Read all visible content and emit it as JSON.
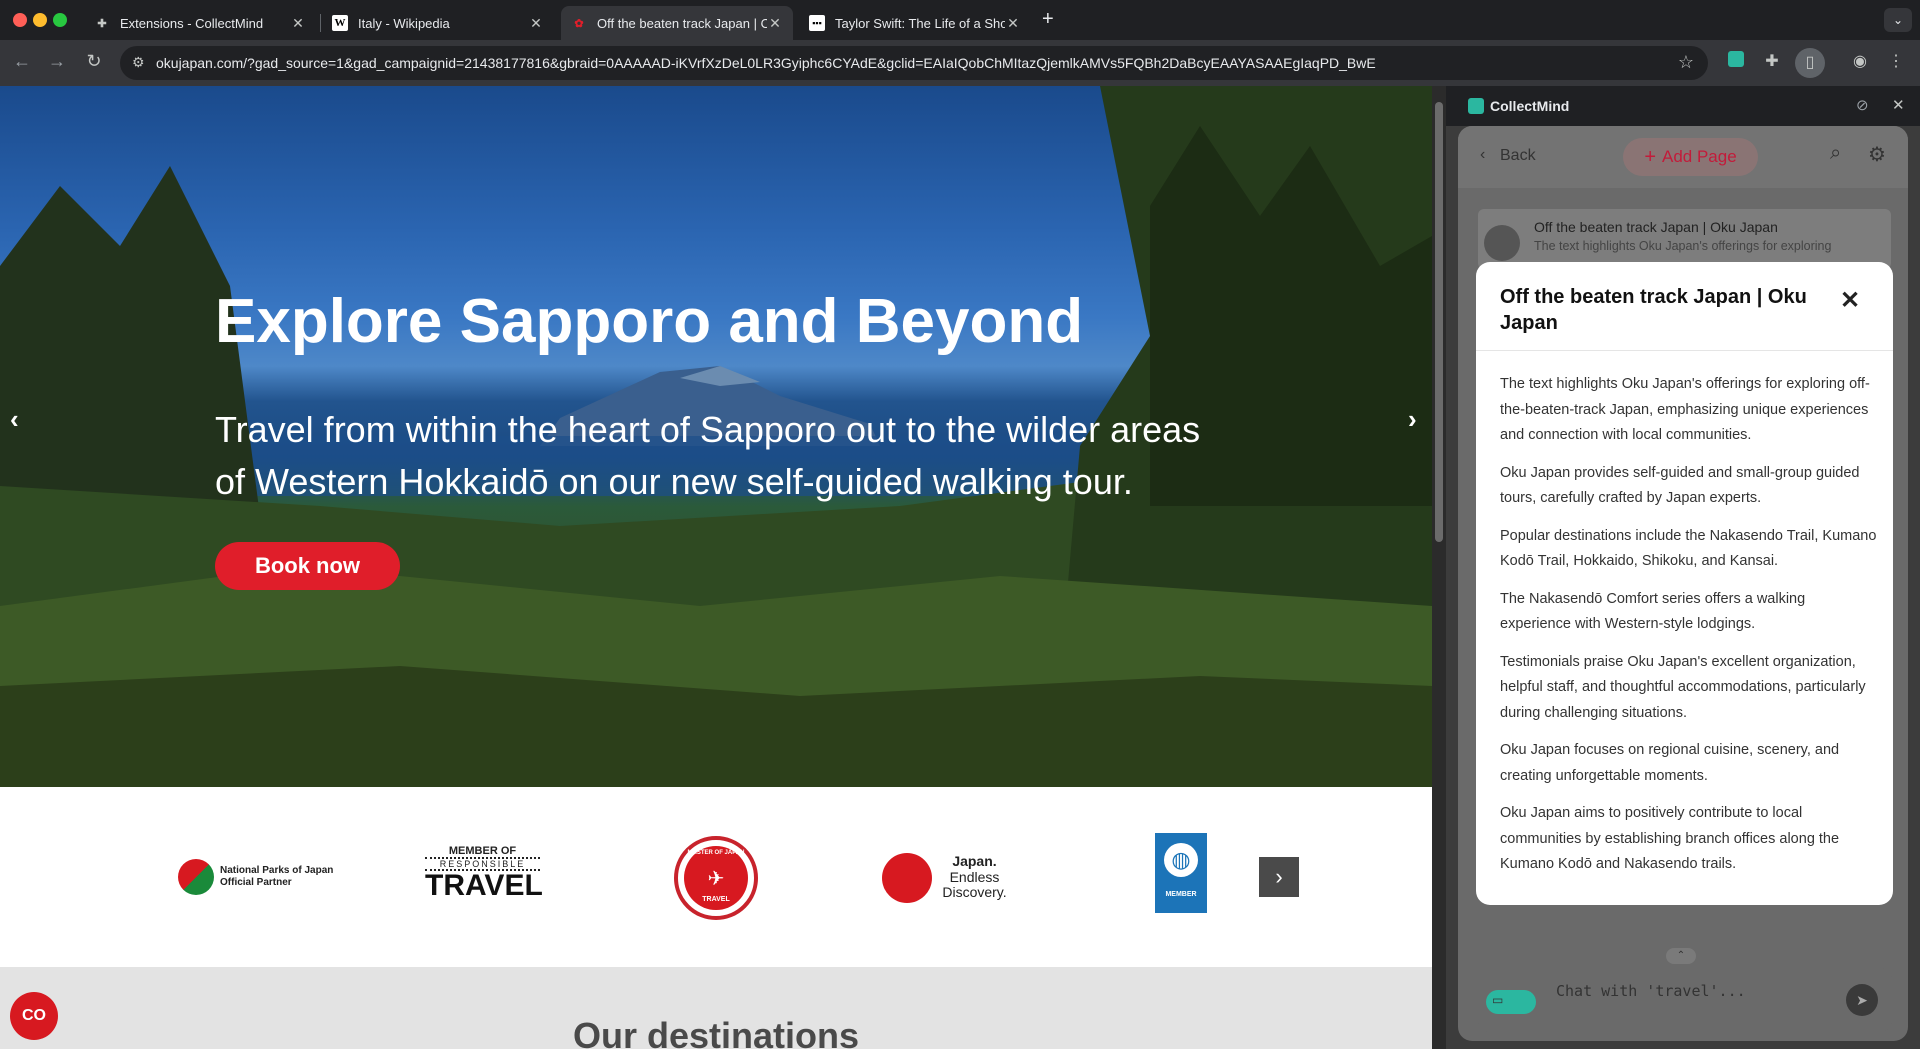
{
  "browser": {
    "tabs": [
      {
        "title": "Extensions - CollectMind",
        "icon": "puzzle-icon"
      },
      {
        "title": "Italy - Wikipedia",
        "icon": "wikipedia-icon"
      },
      {
        "title": "Off the beaten track Japan | O",
        "icon": "okujapan-favicon"
      },
      {
        "title": "Taylor Swift: The Life of a Sho",
        "icon": "site-favicon"
      }
    ],
    "new_tab": "+",
    "url": "okujapan.com/?gad_source=1&gad_campaignid=21438177816&gbraid=0AAAAAD-iKVrfXzDeL0LR3Gyiphc6CYAdE&gclid=EAIaIQobChMItazQjemlkAMVs5FQBh2DaBcyEAAYASAAEgIaqPD_BwE"
  },
  "hero": {
    "title": "Explore Sapporo and Beyond",
    "subtitle": "Travel from within the heart of Sapporo out to the wilder areas of Western Hokkaidō on our new self-guided walking tour.",
    "cta": "Book now"
  },
  "logos": [
    {
      "name": "National Parks of Japan Official Partner",
      "line1": "National Parks of Japan",
      "line2": "Official Partner"
    },
    {
      "name": "Member of Responsible Travel",
      "line1": "MEMBER OF",
      "line2": "RESPONSIBLE",
      "line3": "TRAVEL"
    },
    {
      "name": "Master of Japan Travel",
      "line1": "MASTER OF JAPAN",
      "line2": "TRAVEL"
    },
    {
      "name": "Japan. Endless Discovery.",
      "line1": "Japan.",
      "line2": "Endless",
      "line3": "Discovery."
    },
    {
      "name": "Member badge",
      "line1": "MEMBER"
    }
  ],
  "destinations": {
    "heading": "Our destinations"
  },
  "cc_button": "CO",
  "sidebar": {
    "title": "CollectMind",
    "back": "Back",
    "add_page": "Add Page",
    "card": {
      "title": "Off the beaten track Japan | Oku Japan",
      "snippet": "The text highlights Oku Japan's offerings for exploring"
    },
    "modal": {
      "title": "Off the beaten track Japan | Oku Japan",
      "points": [
        "The text highlights Oku Japan's offerings for exploring off-the-beaten-track Japan, emphasizing unique experiences and connection with local communities.",
        "Oku Japan provides self-guided and small-group guided tours, carefully crafted by Japan experts.",
        "Popular destinations include the Nakasendo Trail, Kumano Kodō Trail, Hokkaido, Shikoku, and Kansai.",
        "The Nakasendō Comfort series offers a walking experience with Western-style lodgings.",
        "Testimonials praise Oku Japan's excellent organization, helpful staff, and thoughtful accommodations, particularly during challenging situations.",
        "Oku Japan focuses on regional cuisine, scenery, and creating unforgettable moments.",
        "Oku Japan aims to positively contribute to local communities by establishing branch offices along the Kumano Kodō and Nakasendo trails."
      ]
    },
    "chat_placeholder": "Chat with 'travel'..."
  }
}
